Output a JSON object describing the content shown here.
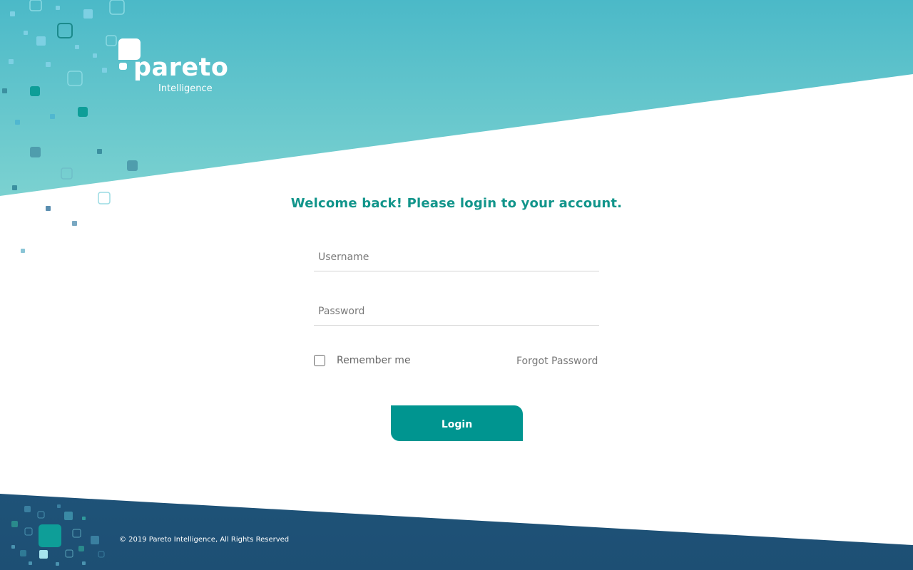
{
  "brand": {
    "name": "pareto",
    "subtitle": "Intelligence",
    "logo_icon": "pareto-logo-icon"
  },
  "colors": {
    "accent": "#009590",
    "heading": "#12958b",
    "header_gradient_top": "#4bb9c8",
    "header_gradient_bottom": "#b9f0e0",
    "footer_gradient": "#1d4f74"
  },
  "login": {
    "heading": "Welcome back! Please login to your account.",
    "username_placeholder": "Username",
    "username_value": "",
    "password_placeholder": "Password",
    "password_value": "",
    "remember_label": "Remember me",
    "remember_checked": false,
    "forgot_label": "Forgot Password",
    "submit_label": "Login"
  },
  "footer": {
    "copyright": "© 2019 Pareto Intelligence, All Rights Reserved"
  }
}
